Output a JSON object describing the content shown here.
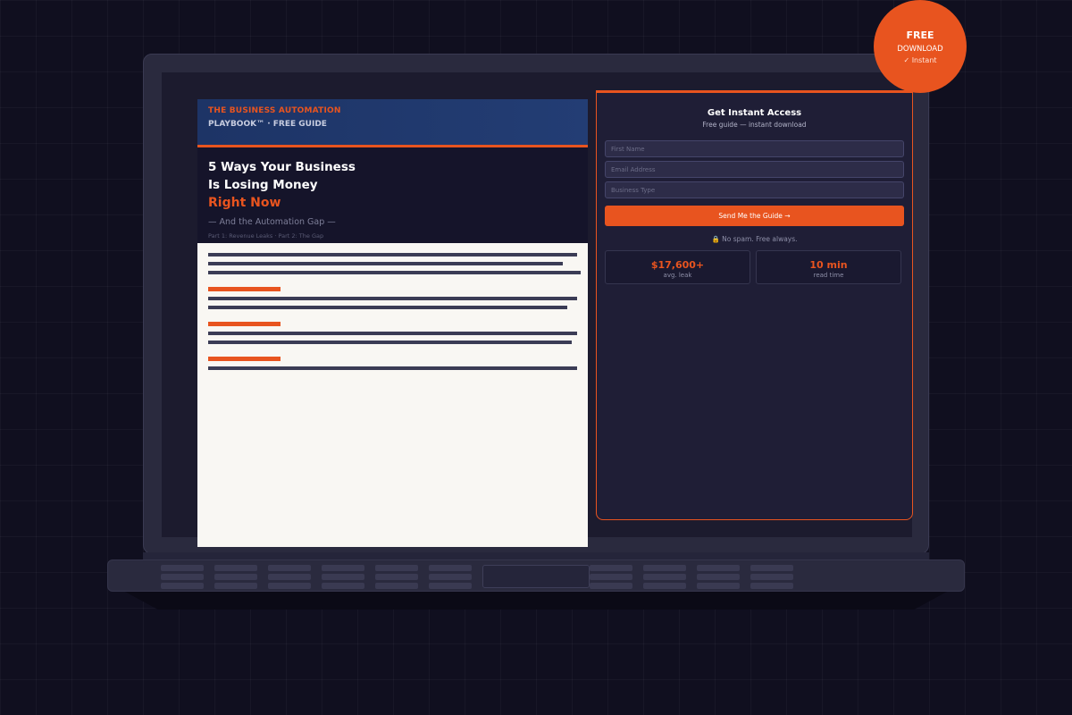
{
  "badge": {
    "line1": "FREE",
    "line2": "DOWNLOAD",
    "line3": "✓ Instant"
  },
  "guide": {
    "brand": "THE BUSINESS AUTOMATION",
    "subtitle": "PLAYBOOK™  ·  FREE GUIDE",
    "headline_line1": "5 Ways Your Business",
    "headline_line2": "Is Losing Money",
    "headline_accent": "Right Now",
    "tagline": "— And the Automation Gap —",
    "parts": "Part 1: Revenue Leaks  ·  Part 2: The Gap"
  },
  "form": {
    "title": "Get Instant Access",
    "subtitle": "Free guide — instant download",
    "fields": {
      "first_name_placeholder": "First Name",
      "email_placeholder": "Email Address",
      "business_type_placeholder": "Business Type"
    },
    "submit_label": "Send Me the Guide →",
    "nospam": "🔒 No spam. Free always.",
    "stats": [
      {
        "value": "$17,600+",
        "label": "avg. leak"
      },
      {
        "value": "10 min",
        "label": "read time"
      }
    ]
  },
  "colors": {
    "accent": "#e8541f",
    "background": "#100f1f",
    "card": "#1f1e36",
    "guide_header": "#1d3466"
  }
}
